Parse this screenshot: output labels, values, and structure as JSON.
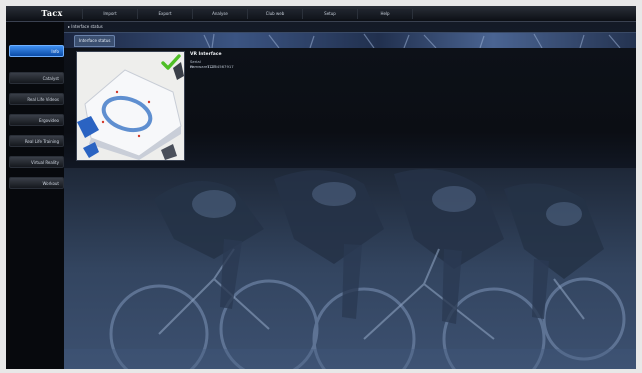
{
  "app": {
    "logo": "Tacx"
  },
  "menu": [
    {
      "label": "Import"
    },
    {
      "label": "Export"
    },
    {
      "label": "Analyse"
    },
    {
      "label": "Club web"
    },
    {
      "label": "Setup"
    },
    {
      "label": "Help"
    }
  ],
  "sidebar": {
    "items": [
      {
        "label": "Info",
        "active": true
      },
      {
        "label": "Catalyst"
      },
      {
        "label": "Real Life Videos"
      },
      {
        "label": "Ergovideo"
      },
      {
        "label": "Real Life Training"
      },
      {
        "label": "Virtual Reality"
      },
      {
        "label": "Workout"
      }
    ]
  },
  "main": {
    "breadcrumb": "▸ Interface status",
    "tab_label": "Interface status",
    "device": {
      "name": "VR Interface",
      "rows": [
        {
          "key": "Serial nr.",
          "value": "T1234567917"
        },
        {
          "key": "Firmware",
          "value": "1.23"
        }
      ],
      "status_icon": "checkmark-icon"
    }
  },
  "colors": {
    "accent_active": "#2f7fe6",
    "check_green": "#4fbf26"
  }
}
